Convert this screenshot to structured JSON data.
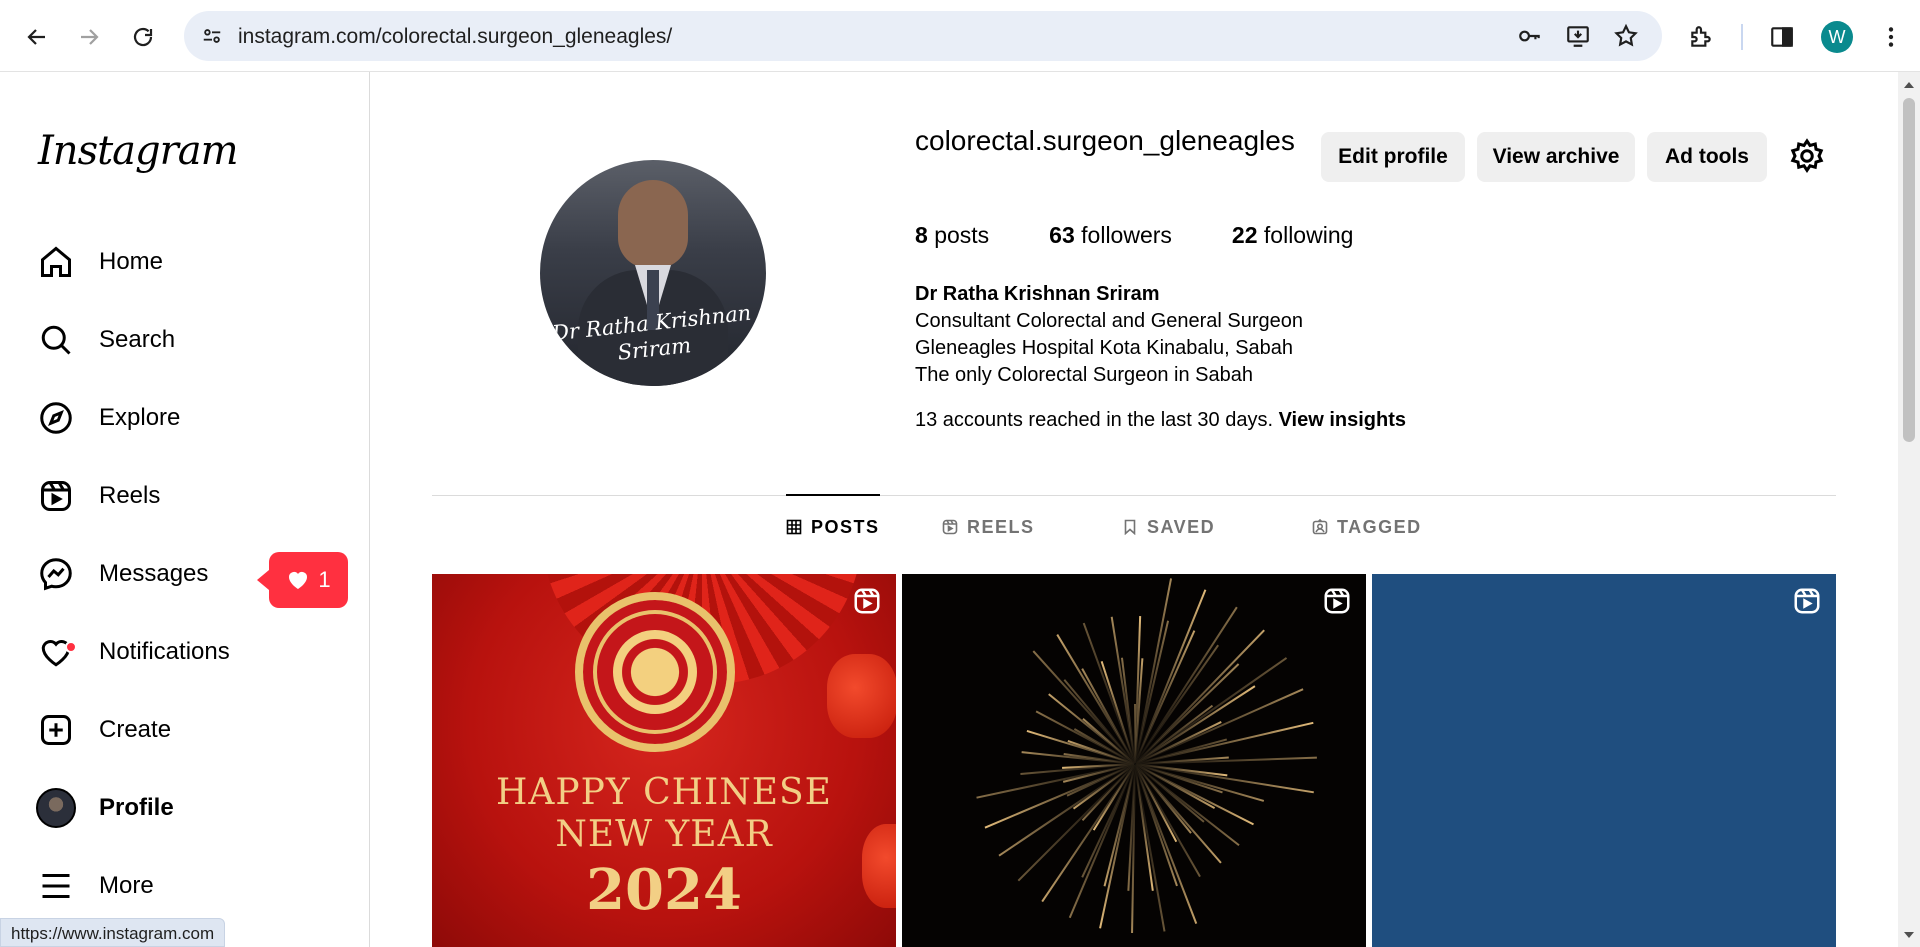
{
  "browser": {
    "url": "instagram.com/colorectal.surgeon_gleneagles/",
    "profile_initial": "W",
    "status_url": "https://www.instagram.com"
  },
  "sidebar": {
    "logo": "Instagram",
    "items": [
      {
        "label": "Home",
        "icon": "home-icon"
      },
      {
        "label": "Search",
        "icon": "search-icon"
      },
      {
        "label": "Explore",
        "icon": "compass-icon"
      },
      {
        "label": "Reels",
        "icon": "reels-icon"
      },
      {
        "label": "Messages",
        "icon": "messenger-icon"
      },
      {
        "label": "Notifications",
        "icon": "heart-icon"
      },
      {
        "label": "Create",
        "icon": "plus-square-icon"
      },
      {
        "label": "Profile",
        "icon": "avatar"
      },
      {
        "label": "More",
        "icon": "menu-icon"
      }
    ],
    "notification_count": "1"
  },
  "profile": {
    "username": "colorectal.surgeon_gleneagles",
    "buttons": {
      "edit": "Edit profile",
      "archive": "View archive",
      "ad_tools": "Ad tools"
    },
    "stats": {
      "posts_count": "8",
      "posts_label": "posts",
      "followers_count": "63",
      "followers_label": "followers",
      "following_count": "22",
      "following_label": "following"
    },
    "full_name": "Dr Ratha Krishnan Sriram",
    "bio_lines": [
      "Consultant Colorectal and General Surgeon",
      "Gleneagles Hospital Kota Kinabalu, Sabah",
      "The only Colorectal Surgeon in Sabah"
    ],
    "insights_text": "13 accounts reached in the last 30 days.",
    "insights_link": "View insights",
    "photo_signature": [
      "Dr Ratha Krishnan",
      "Sriram"
    ]
  },
  "tabs": [
    {
      "label": "POSTS",
      "active": true
    },
    {
      "label": "REELS",
      "active": false
    },
    {
      "label": "SAVED",
      "active": false
    },
    {
      "label": "TAGGED",
      "active": false
    }
  ],
  "posts": [
    {
      "lines": [
        "HAPPY CHINESE",
        "NEW YEAR",
        "2024"
      ],
      "type": "reel"
    },
    {
      "type": "reel"
    },
    {
      "type": "reel"
    }
  ]
}
